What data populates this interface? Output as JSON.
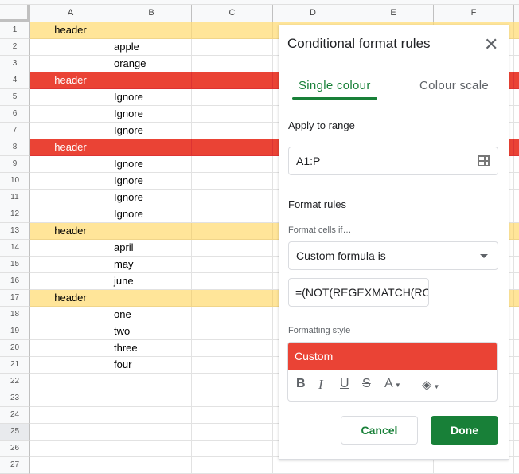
{
  "columns": [
    "A",
    "B",
    "C",
    "D",
    "E",
    "F"
  ],
  "rows": [
    {
      "num": "1",
      "a": "header",
      "b": "",
      "style": "yellow"
    },
    {
      "num": "2",
      "a": "",
      "b": "apple",
      "style": ""
    },
    {
      "num": "3",
      "a": "",
      "b": "orange",
      "style": ""
    },
    {
      "num": "4",
      "a": "header",
      "b": "",
      "style": "red"
    },
    {
      "num": "5",
      "a": "",
      "b": "Ignore",
      "style": ""
    },
    {
      "num": "6",
      "a": "",
      "b": "Ignore",
      "style": ""
    },
    {
      "num": "7",
      "a": "",
      "b": "Ignore",
      "style": ""
    },
    {
      "num": "8",
      "a": "header",
      "b": "",
      "style": "red"
    },
    {
      "num": "9",
      "a": "",
      "b": "Ignore",
      "style": ""
    },
    {
      "num": "10",
      "a": "",
      "b": "Ignore",
      "style": ""
    },
    {
      "num": "11",
      "a": "",
      "b": "Ignore",
      "style": ""
    },
    {
      "num": "12",
      "a": "",
      "b": "Ignore",
      "style": ""
    },
    {
      "num": "13",
      "a": "header",
      "b": "",
      "style": "yellow"
    },
    {
      "num": "14",
      "a": "",
      "b": "april",
      "style": ""
    },
    {
      "num": "15",
      "a": "",
      "b": "may",
      "style": ""
    },
    {
      "num": "16",
      "a": "",
      "b": "june",
      "style": ""
    },
    {
      "num": "17",
      "a": "header",
      "b": "",
      "style": "yellow"
    },
    {
      "num": "18",
      "a": "",
      "b": "one",
      "style": ""
    },
    {
      "num": "19",
      "a": "",
      "b": "two",
      "style": ""
    },
    {
      "num": "20",
      "a": "",
      "b": "three",
      "style": ""
    },
    {
      "num": "21",
      "a": "",
      "b": "four",
      "style": ""
    },
    {
      "num": "22",
      "a": "",
      "b": "",
      "style": ""
    },
    {
      "num": "23",
      "a": "",
      "b": "",
      "style": ""
    },
    {
      "num": "24",
      "a": "",
      "b": "",
      "style": ""
    },
    {
      "num": "25",
      "a": "",
      "b": "",
      "style": "",
      "selected": true
    },
    {
      "num": "26",
      "a": "",
      "b": "",
      "style": ""
    },
    {
      "num": "27",
      "a": "",
      "b": "",
      "style": ""
    }
  ],
  "colors": {
    "yellow": "#ffe599",
    "red": "#ea4335",
    "accent": "#188038"
  },
  "panel": {
    "title": "Conditional format rules",
    "close_icon": "close-icon",
    "tabs": [
      {
        "label": "Single colour",
        "active": true
      },
      {
        "label": "Colour scale",
        "active": false
      }
    ],
    "apply_label": "Apply to range",
    "range_value": "A1:P",
    "range_icon": "grid-select-icon",
    "format_rules_label": "Format rules",
    "format_cells_if_label": "Format cells if…",
    "condition_value": "Custom formula is",
    "formula_value": "=(NOT(REGEXMATCH(RO",
    "formatting_style_label": "Formatting style",
    "style_preview": "Custom",
    "tools": {
      "bold": "B",
      "italic": "I",
      "underline": "U",
      "strike": "S",
      "text_color": "A",
      "fill_icon": "paint-bucket-icon"
    },
    "cancel_label": "Cancel",
    "done_label": "Done"
  }
}
